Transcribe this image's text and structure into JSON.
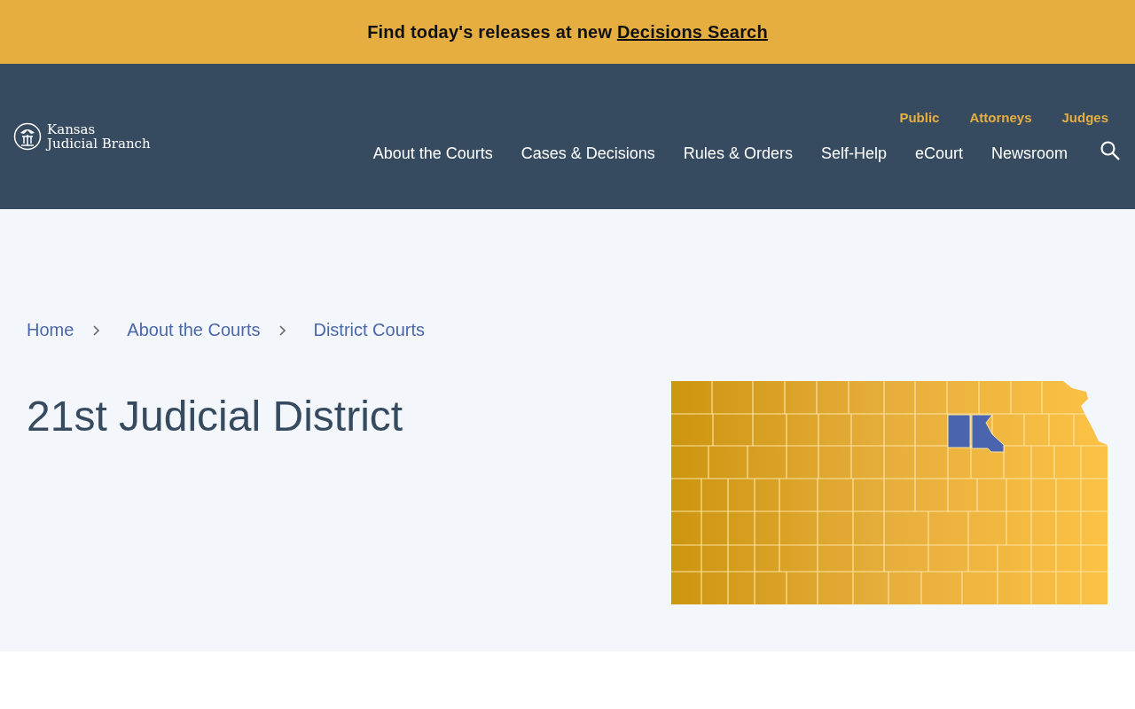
{
  "banner": {
    "text": "Find today's releases at new ",
    "link": "Decisions Search"
  },
  "logo": {
    "line_1": "Kansas",
    "line_2": "Judicial Branch"
  },
  "audience_links": [
    "Public",
    "Attorneys",
    "Judges"
  ],
  "nav_items": [
    "About the Courts",
    "Cases & Decisions",
    "Rules & Orders",
    "Self-Help",
    "eCourt",
    "Newsroom"
  ],
  "breadcrumbs": [
    "Home",
    "About the Courts",
    "District Courts"
  ],
  "title": "21st Judicial District"
}
